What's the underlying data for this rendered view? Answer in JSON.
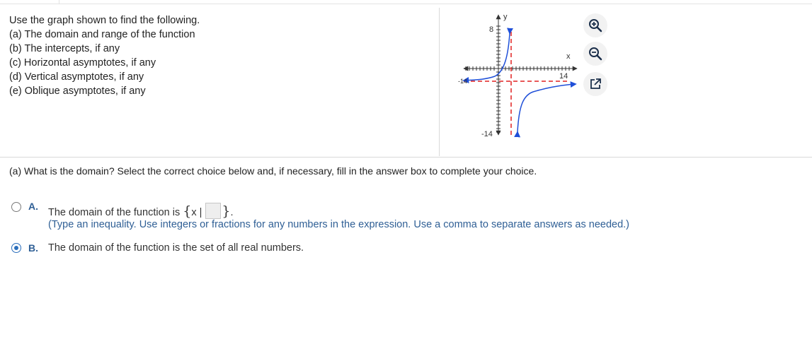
{
  "instructions": {
    "lines": [
      "Use the graph shown to find the following.",
      "(a) The domain and range of the function",
      "(b) The intercepts, if any",
      "(c) Horizontal asymptotes, if any",
      "(d) Vertical asymptotes, if any",
      "(e) Oblique asymptotes, if any"
    ]
  },
  "graph": {
    "y_axis_label": "y",
    "x_axis_label": "x",
    "y_max_tick": "8",
    "y_min_tick": "-14",
    "x_max_tick": "14",
    "x_min_tick": "-14",
    "axis_color": "#333333",
    "curve_color": "#1f4fd8",
    "asymptote_color": "#e02020"
  },
  "toolbar": {
    "zoom_in_icon": "zoom-in-icon",
    "zoom_out_icon": "zoom-out-icon",
    "popout_icon": "popout-icon"
  },
  "question": {
    "text": "(a) What is the domain? Select the correct choice below and, if necessary, fill in the answer box to complete your choice."
  },
  "choices": {
    "a": {
      "letter": "A.",
      "prefix": "The domain of the function is",
      "set_open": "{",
      "set_var": "x |",
      "set_close": "}",
      "set_end": ".",
      "hint": "(Type an inequality. Use integers or fractions for any numbers in the expression. Use a comma to separate answers as needed.)",
      "selected": false
    },
    "b": {
      "letter": "B.",
      "text": "The domain of the function is the set of all real numbers.",
      "selected": true
    }
  },
  "colors": {
    "accent": "#2a6ebb",
    "letter": "#2f5f95"
  }
}
